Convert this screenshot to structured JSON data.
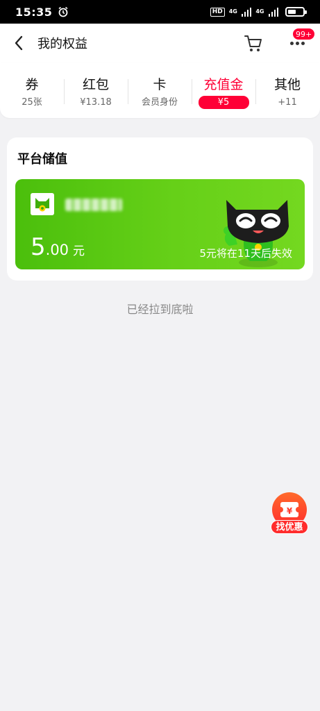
{
  "status_bar": {
    "time": "15:35",
    "hd_label": "HD",
    "network_1": "4G",
    "network_2": "4G"
  },
  "header": {
    "title": "我的权益",
    "cart_icon": "cart-icon",
    "more_icon": "more-icon",
    "message_badge": "99+"
  },
  "tabs": [
    {
      "label": "券",
      "sub": "25张"
    },
    {
      "label": "红包",
      "sub": "¥13.18"
    },
    {
      "label": "卡",
      "sub": "会员身份"
    },
    {
      "label": "充值金",
      "sub": "¥5",
      "active": true
    },
    {
      "label": "其他",
      "sub": "+11"
    }
  ],
  "stored_value": {
    "section_title": "平台储值",
    "balance_integer": "5",
    "balance_decimal": ".00",
    "unit": "元",
    "expire_note": "5元将在11天后失效"
  },
  "end_text": "已经拉到底啦",
  "floating_button": {
    "label": "找优惠",
    "icon": "coupon-icon"
  },
  "colors": {
    "accent": "#ff0036",
    "card_green": "#5ccb12",
    "fab": "#ff3b2f"
  }
}
